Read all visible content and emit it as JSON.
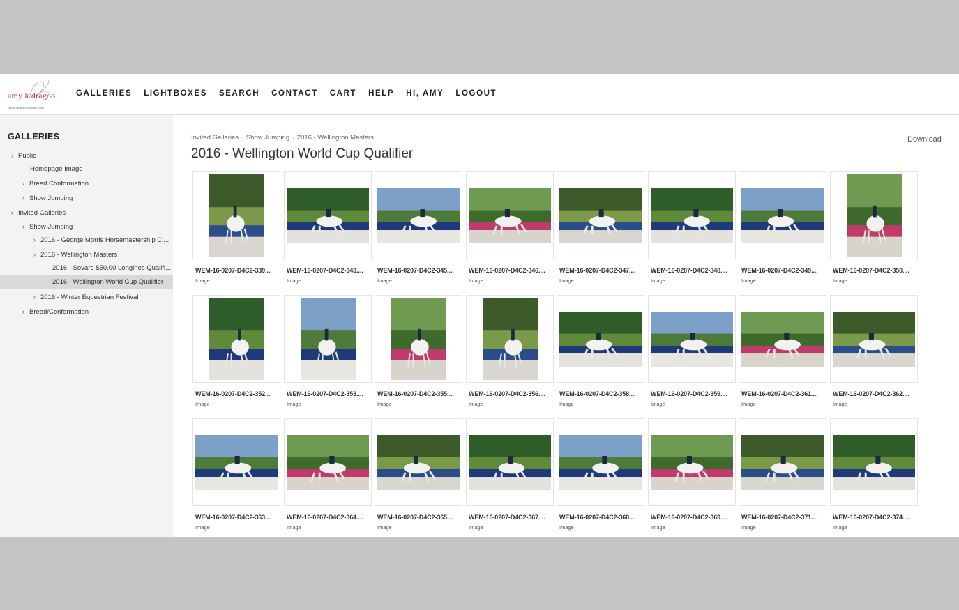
{
  "header": {
    "logo_text": "amy k dragoo",
    "logo_url": "www.akdragoophoto.com",
    "nav": [
      "GALLERIES",
      "LIGHTBOXES",
      "SEARCH",
      "CONTACT",
      "CART",
      "HELP",
      "HI, AMY",
      "LOGOUT"
    ]
  },
  "sidebar": {
    "title": "GALLERIES",
    "items": [
      {
        "label": "Public",
        "chevron": "›"
      },
      {
        "label": "Homepage Image",
        "chevron": ""
      },
      {
        "label": "Breed Conformation",
        "chevron": "›"
      },
      {
        "label": "Show Jumping",
        "chevron": "›"
      },
      {
        "label": "Invited Galleries",
        "chevron": "›"
      },
      {
        "label": "Show Jumping",
        "chevron": "›"
      },
      {
        "label": "2016 - George Morris Horsemastership Cl...",
        "chevron": "›"
      },
      {
        "label": "2016 - Wellington Masters",
        "chevron": "›"
      },
      {
        "label": "2016 - Sovaro $50,00 Longines Qualifi...",
        "chevron": ""
      },
      {
        "label": "2016 - Wellington World Cup Qualifier",
        "chevron": ""
      },
      {
        "label": "2016 - Winter Equestrian Festival",
        "chevron": "›"
      },
      {
        "label": "Breed/Conformation",
        "chevron": "›"
      }
    ]
  },
  "breadcrumb": [
    "Invited Galleries",
    "Show Jumping",
    "2016 - Wellington Masters"
  ],
  "page_title": "2016 - Wellington World Cup Qualifier",
  "download_label": "Download",
  "images": [
    {
      "name": "WEM-16-0207-D4C2-339....",
      "type": "Image"
    },
    {
      "name": "WEM-16-0207-D4C2-343....",
      "type": "Image"
    },
    {
      "name": "WEM-16-0207-D4C2-345....",
      "type": "Image"
    },
    {
      "name": "WEM-16-0207-D4C2-346....",
      "type": "Image"
    },
    {
      "name": "WEM-16-0207-D4C2-347....",
      "type": "Image"
    },
    {
      "name": "WEM-16-0207-D4C2-348....",
      "type": "Image"
    },
    {
      "name": "WEM-16-0207-D4C2-349....",
      "type": "Image"
    },
    {
      "name": "WEM-16-0207-D4C2-350....",
      "type": "Image"
    },
    {
      "name": "WEM-16-0207-D4C2-352....",
      "type": "Image"
    },
    {
      "name": "WEM-16-0207-D4C2-353....",
      "type": "Image"
    },
    {
      "name": "WEM-16-0207-D4C2-355....",
      "type": "Image"
    },
    {
      "name": "WEM-16-0207-D4C2-356....",
      "type": "Image"
    },
    {
      "name": "WEM-16-0207-D4C2-358....",
      "type": "Image"
    },
    {
      "name": "WEM-16-0207-D4C2-359....",
      "type": "Image"
    },
    {
      "name": "WEM-16-0207-D4C2-361....",
      "type": "Image"
    },
    {
      "name": "WEM-16-0207-D4C2-362....",
      "type": "Image"
    },
    {
      "name": "WEM-16-0207-D4C2-363....",
      "type": "Image"
    },
    {
      "name": "WEM-16-0207-D4C2-364....",
      "type": "Image"
    },
    {
      "name": "WEM-16-0207-D4C2-365....",
      "type": "Image"
    },
    {
      "name": "WEM-16-0207-D4C2-367....",
      "type": "Image"
    },
    {
      "name": "WEM-16-0207-D4C2-368....",
      "type": "Image"
    },
    {
      "name": "WEM-16-0207-D4C2-369....",
      "type": "Image"
    },
    {
      "name": "WEM-16-0207-D4C2-371....",
      "type": "Image"
    },
    {
      "name": "WEM-16-0207-D4C2-374....",
      "type": "Image"
    }
  ],
  "colors": {
    "page_bg": "#c4c5c7",
    "sidebar_bg": "#f3f3f3",
    "active_item_bg": "#d9d9d9",
    "logo_red": "#b3313a",
    "sponsor_blue": "#1f3a7a"
  }
}
